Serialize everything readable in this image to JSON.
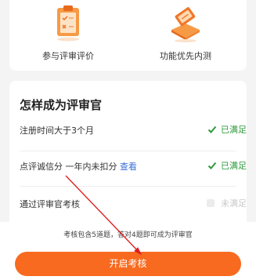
{
  "benefits": [
    {
      "label": "参与评审评价",
      "icon": "clipboard-icon"
    },
    {
      "label": "功能优先内测",
      "icon": "ticket-icon"
    }
  ],
  "requirements": {
    "title": "怎样成为评审官",
    "items": [
      {
        "text": "注册时间大于3个月",
        "link": "",
        "status": "已满足",
        "met": true
      },
      {
        "text": "点评诚信分 一年内未扣分",
        "link": "查看",
        "status": "已满足",
        "met": true
      },
      {
        "text": "通过评审官考核",
        "link": "",
        "status": "未满足",
        "met": false
      }
    ]
  },
  "bottom": {
    "hint": "考核包含5道题，答对4题即可成为评审官",
    "button_label": "开启考核"
  },
  "colors": {
    "accent": "#f76a1f",
    "met": "#2c9a3a",
    "link": "#3a6fd8",
    "annotation_arrow": "#e02020"
  }
}
